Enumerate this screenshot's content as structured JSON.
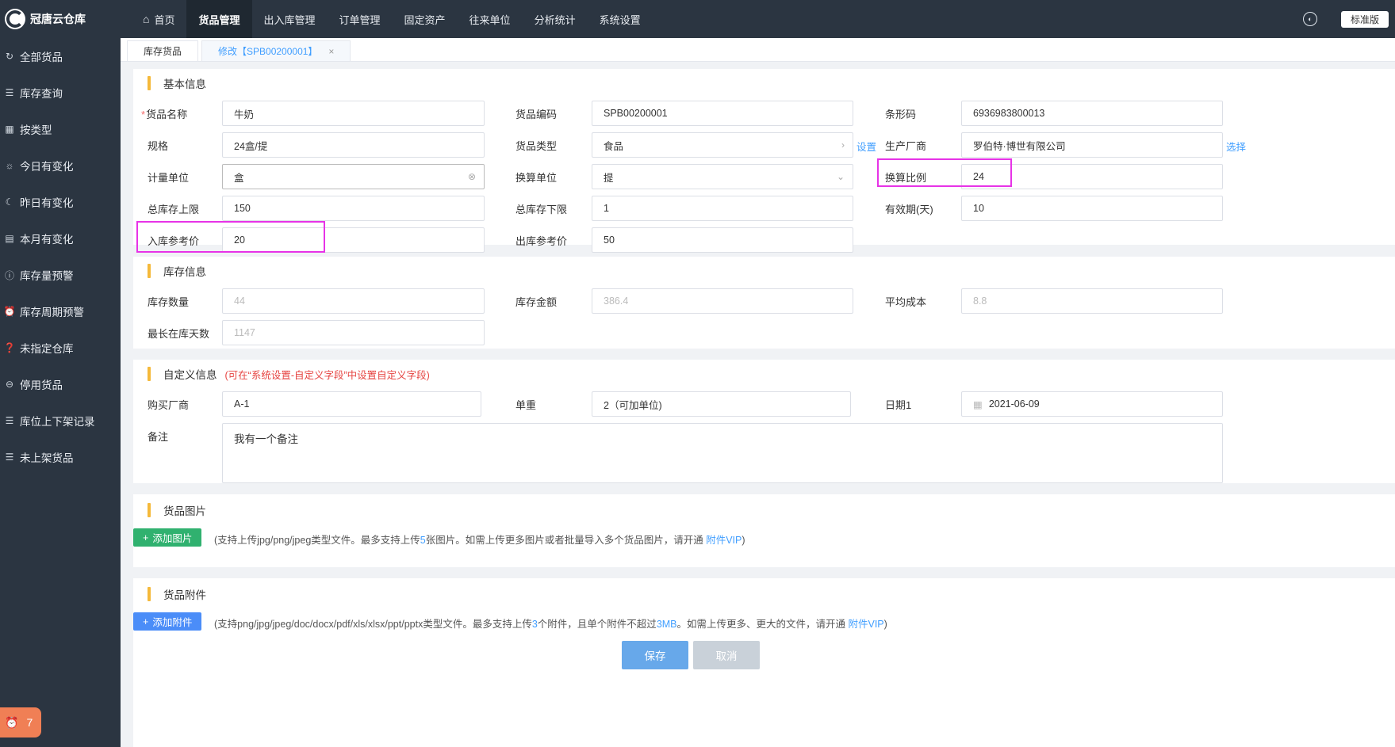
{
  "app": {
    "title": "冠唐云仓库",
    "version": "标准版"
  },
  "topnav": [
    {
      "label": "首页"
    },
    {
      "label": "货品管理"
    },
    {
      "label": "出入库管理"
    },
    {
      "label": "订单管理"
    },
    {
      "label": "固定资产"
    },
    {
      "label": "往来单位"
    },
    {
      "label": "分析统计"
    },
    {
      "label": "系统设置"
    }
  ],
  "sidebar": {
    "items": [
      {
        "label": "全部货品",
        "icon": "refresh-icon"
      },
      {
        "label": "库存查询",
        "icon": "list-icon"
      },
      {
        "label": "按类型",
        "icon": "grid-icon"
      },
      {
        "label": "今日有变化",
        "icon": "sun-icon"
      },
      {
        "label": "昨日有变化",
        "icon": "moon-icon"
      },
      {
        "label": "本月有变化",
        "icon": "calendar-icon"
      },
      {
        "label": "库存量预警",
        "icon": "alert-icon"
      },
      {
        "label": "库存周期预警",
        "icon": "clock-icon"
      },
      {
        "label": "未指定仓库",
        "icon": "question-icon"
      },
      {
        "label": "停用货品",
        "icon": "stop-icon"
      },
      {
        "label": "库位上下架记录",
        "icon": "list-icon"
      },
      {
        "label": "未上架货品",
        "icon": "list-icon"
      }
    ],
    "badge_count": "7"
  },
  "tabs": [
    {
      "label": "库存货品"
    },
    {
      "label": "修改【SPB00200001】",
      "close": "×"
    }
  ],
  "basic": {
    "title": "基本信息",
    "required_mark": "*",
    "name_label": "货品名称",
    "name_value": "牛奶",
    "code_label": "货品编码",
    "code_value": "SPB00200001",
    "barcode_label": "条形码",
    "barcode_value": "6936983800013",
    "spec_label": "规格",
    "spec_value": "24盒/提",
    "type_label": "货品类型",
    "type_value": "食品",
    "type_link": "设置",
    "maker_label": "生产厂商",
    "maker_value": "罗伯特·博世有限公司",
    "maker_link": "选择",
    "unit_label": "计量单位",
    "unit_value": "盒",
    "conv_unit_label": "换算单位",
    "conv_unit_value": "提",
    "ratio_label": "换算比例",
    "ratio_value": "24",
    "max_label": "总库存上限",
    "max_value": "150",
    "min_label": "总库存下限",
    "min_value": "1",
    "expiry_label": "有效期(天)",
    "expiry_value": "10",
    "in_price_label": "入库参考价",
    "in_price_value": "20",
    "out_price_label": "出库参考价",
    "out_price_value": "50"
  },
  "stock": {
    "title": "库存信息",
    "qty_label": "库存数量",
    "qty_value": "44",
    "amount_label": "库存金额",
    "amount_value": "386.4",
    "avg_label": "平均成本",
    "avg_value": "8.8",
    "days_label": "最长在库天数",
    "days_value": "1147"
  },
  "custom": {
    "title": "自定义信息",
    "hint": "(可在“系统设置-自定义字段”中设置自定义字段)",
    "buyer_label": "购买厂商",
    "buyer_value": "A-1",
    "weight_label": "单重",
    "weight_value": "2（可加单位)",
    "date_label": "日期1",
    "date_value": "2021-06-09",
    "note_label": "备注",
    "note_value": "我有一个备注"
  },
  "images": {
    "title": "货品图片",
    "button": "添加图片",
    "hint_a": "(支持上传jpg/png/jpeg类型文件。最多支持上传",
    "hint_n": "5",
    "hint_b": "张图片。如需上传更多图片或者批量导入多个货品图片，请开通 ",
    "hint_link": "附件VIP",
    "hint_c": ")"
  },
  "attachments": {
    "title": "货品附件",
    "button": "添加附件",
    "hint_a": "(支持png/jpg/jpeg/doc/docx/pdf/xls/xlsx/ppt/pptx类型文件。最多支持上传",
    "hint_n": "3",
    "hint_b": "个附件，且单个附件不超过",
    "hint_size": "3MB",
    "hint_c": "。如需上传更多、更大的文件，请开通 ",
    "hint_link": "附件VIP",
    "hint_d": ")"
  },
  "actions": {
    "save": "保存",
    "cancel": "取消"
  },
  "colors": {
    "sidebar": "#2b3541",
    "accent": "#409eff",
    "highlight": "#e733e7",
    "section_bar": "#f5b93a"
  }
}
